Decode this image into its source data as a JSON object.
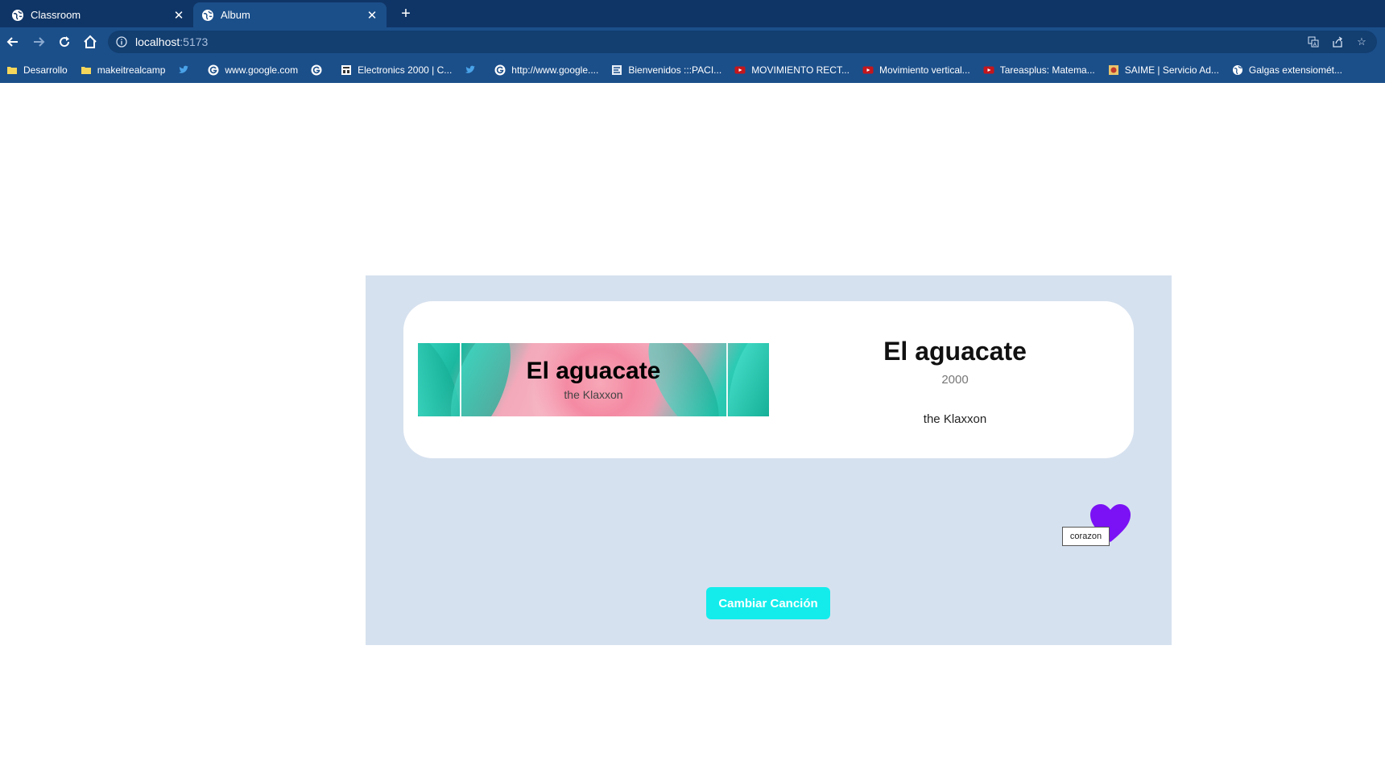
{
  "browser": {
    "tabs": [
      {
        "label": "Classroom",
        "active": false
      },
      {
        "label": "Album",
        "active": true
      }
    ],
    "new_tab_symbol": "+",
    "address": {
      "host": "localhost",
      "port": ":5173"
    },
    "bookmarks": [
      {
        "icon": "folder-icon",
        "label": "Desarrollo"
      },
      {
        "icon": "folder-icon",
        "label": "makeitrealcamp"
      },
      {
        "icon": "twitter-icon",
        "label": ""
      },
      {
        "icon": "google-icon",
        "label": "www.google.com"
      },
      {
        "icon": "google-icon",
        "label": ""
      },
      {
        "icon": "electronics-icon",
        "label": "Electronics 2000 | C..."
      },
      {
        "icon": "twitter-icon",
        "label": ""
      },
      {
        "icon": "google-icon",
        "label": "http://www.google...."
      },
      {
        "icon": "paci-icon",
        "label": "Bienvenidos :::PACI..."
      },
      {
        "icon": "youtube-icon",
        "label": "MOVIMIENTO RECT..."
      },
      {
        "icon": "youtube-icon",
        "label": "Movimiento vertical..."
      },
      {
        "icon": "youtube-icon",
        "label": "Tareasplus: Matema..."
      },
      {
        "icon": "saime-icon",
        "label": "SAIME | Servicio Ad..."
      },
      {
        "icon": "globe-icon",
        "label": "Galgas extensiomét..."
      }
    ]
  },
  "album": {
    "banner_title": "El aguacate",
    "banner_artist": "the Klaxxon",
    "title": "El aguacate",
    "year": "2000",
    "artist": "the Klaxxon"
  },
  "heart": {
    "color": "#7a12f5",
    "tooltip": "corazon"
  },
  "cta": {
    "label": "Cambiar Canción",
    "color": "#14ecec"
  }
}
